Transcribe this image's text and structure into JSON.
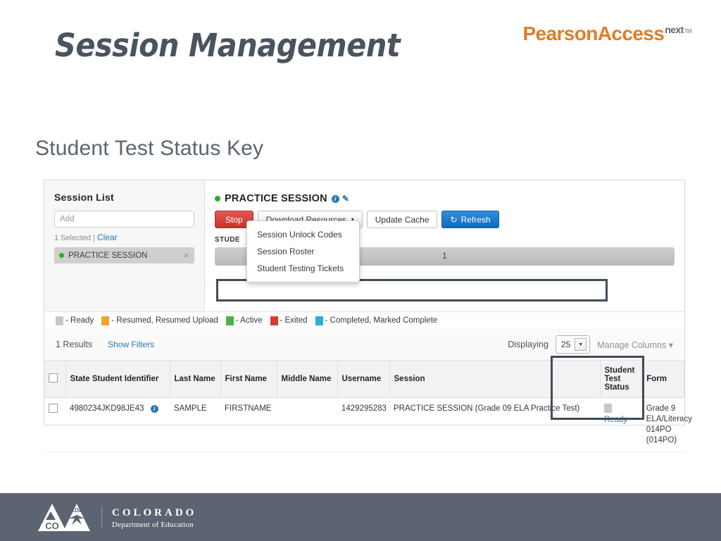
{
  "slide": {
    "title": "Session Management",
    "subtitle": "Student Test Status Key",
    "brand": {
      "name": "PearsonAccess",
      "superscript": "next",
      "tm": "TM",
      "color": "#e07c26"
    }
  },
  "session_list": {
    "title": "Session List",
    "add_placeholder": "Add",
    "selected_text": "1 Selected",
    "separator": "|",
    "clear_label": "Clear",
    "items": [
      {
        "name": "PRACTICE SESSION",
        "status_color": "#27ae27",
        "remove_label": "×"
      }
    ]
  },
  "session_detail": {
    "title": "PRACTICE SESSION",
    "status_color": "#27ae27",
    "info_icon": "info-icon",
    "edit_icon": "pencil-icon",
    "buttons": {
      "stop": "Stop",
      "download_resources": "Download Resources",
      "caret": "▾",
      "update_cache": "Update Cache",
      "refresh": "Refresh",
      "refresh_glyph": "↻"
    },
    "dropdown_items": [
      "Session Unlock Codes",
      "Session Roster",
      "Student Testing Tickets"
    ],
    "student_label": "STUDE",
    "progress_value": "1"
  },
  "legend": {
    "items": [
      {
        "color": "#c8c8c8",
        "label": "- Ready"
      },
      {
        "color": "#f0a42a",
        "label": "- Resumed, Resumed Upload"
      },
      {
        "color": "#49b349",
        "label": "- Active"
      },
      {
        "color": "#dc3b32",
        "label": "- Exited"
      },
      {
        "color": "#2eaed4",
        "label": "- Completed, Marked Complete"
      }
    ]
  },
  "results_bar": {
    "count": "1 Results",
    "show_filters": "Show Filters",
    "displaying_label": "Displaying",
    "page_size": "25",
    "manage_columns": "Manage Columns",
    "caret": "▾"
  },
  "table": {
    "columns": [
      "State Student Identifier",
      "Last Name",
      "First Name",
      "Middle Name",
      "Username",
      "Session",
      "Student Test Status",
      "Form"
    ],
    "rows": [
      {
        "state_student_identifier": "4980234JKD98JE43",
        "last_name": "SAMPLE",
        "first_name": "FIRSTNAME",
        "middle_name": "",
        "username": "1429295283",
        "session": "PRACTICE SESSION (Grade 09 ELA Practice Test)",
        "student_test_status": "Ready",
        "status_color": "#c8c8c8",
        "form": "Grade 9 ELA/Literacy 014PO (014PO)"
      }
    ]
  },
  "footer": {
    "org_line1": "COLORADO",
    "org_line2": "Department of Education",
    "seal_left_text": "CO",
    "seal_right_text": "CDE",
    "background": "#5b6470"
  }
}
